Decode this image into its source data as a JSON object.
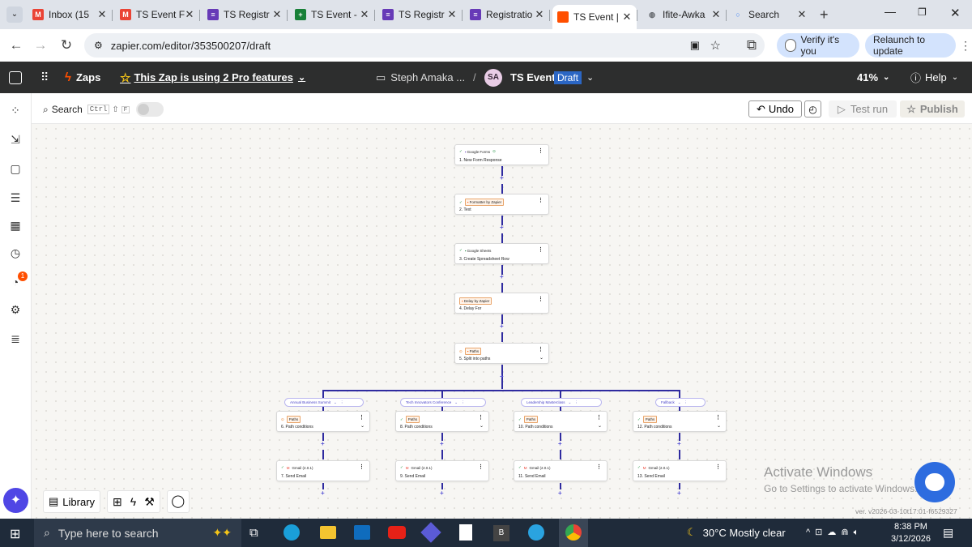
{
  "browser": {
    "tabs": [
      {
        "label": "Inbox (15",
        "icon": "gmail-icon",
        "color": "#ea4335",
        "letter": "M"
      },
      {
        "label": "TS Event F",
        "icon": "gmail-icon",
        "color": "#ea4335",
        "letter": "M"
      },
      {
        "label": "TS Registr",
        "icon": "forms-icon",
        "color": "#673ab7",
        "letter": "≡"
      },
      {
        "label": "TS Event -",
        "icon": "sheets-icon",
        "color": "#188038",
        "letter": "+"
      },
      {
        "label": "TS Registr",
        "icon": "forms-icon",
        "color": "#673ab7",
        "letter": "≡"
      },
      {
        "label": "Registratio",
        "icon": "forms-icon",
        "color": "#673ab7",
        "letter": "≡"
      },
      {
        "label": "TS Event |",
        "icon": "zapier-icon",
        "color": "#ff4f00",
        "letter": ""
      },
      {
        "label": "Ifite-Awka",
        "icon": "globe-icon",
        "color": "#5f6368",
        "letter": "◍"
      },
      {
        "label": "Search",
        "icon": "search-ring-icon",
        "color": "#4285f4",
        "letter": "○"
      }
    ],
    "new_tab": "+",
    "url": "zapier.com/editor/353500207/draft",
    "verify": "Verify it's you",
    "relaunch": "Relaunch to update"
  },
  "zap": {
    "zaps": "Zaps",
    "pro": "This Zap is using 2 Pro features",
    "folder": "Steph Amaka ...",
    "sep": "/",
    "avatar": "SA",
    "name": "TS Event",
    "status": "Draft",
    "zoom": "41%",
    "help": "Help",
    "search": "Search",
    "shortcut": [
      "Ctrl",
      "⇧",
      "F"
    ],
    "undo": "Undo",
    "test_run": "Test run",
    "publish": "Publish",
    "library": "Library",
    "version": "ver. v2026-03-10t17:01-f6529327",
    "notif_count": "1"
  },
  "steps": [
    {
      "app": "Google Forms",
      "title": "1. New Form Response"
    },
    {
      "app": "Formatter by Zapier",
      "title": "2. Text"
    },
    {
      "app": "Google Sheets",
      "title": "3. Create Spreadsheet Row"
    },
    {
      "app": "Delay by Zapier",
      "title": "4. Delay For"
    },
    {
      "app": "Paths",
      "title": "5. Split into paths"
    }
  ],
  "branches": [
    {
      "name": "Annual Business Summit",
      "path": "Paths",
      "cond": "6. Path conditions",
      "email": "7. Send Email"
    },
    {
      "name": "Tech Innovators Conference",
      "path": "Paths",
      "cond": "8. Path conditions",
      "email": "9. Send Email"
    },
    {
      "name": "Leadership Masterclass",
      "path": "Paths",
      "cond": "10. Path conditions",
      "email": "11. Send Email"
    },
    {
      "name": "Fallback",
      "path": "Paths",
      "cond": "12. Path conditions",
      "email": "13. Send Email"
    }
  ],
  "gmail": "Gmail (2.0.1)",
  "watermark": {
    "line1": "Activate Windows",
    "line2": "Go to Settings to activate Windows."
  },
  "taskbar": {
    "search": "Type here to search",
    "weather": "30°C  Mostly clear",
    "time": "8:38 PM",
    "date": "3/12/2026"
  }
}
